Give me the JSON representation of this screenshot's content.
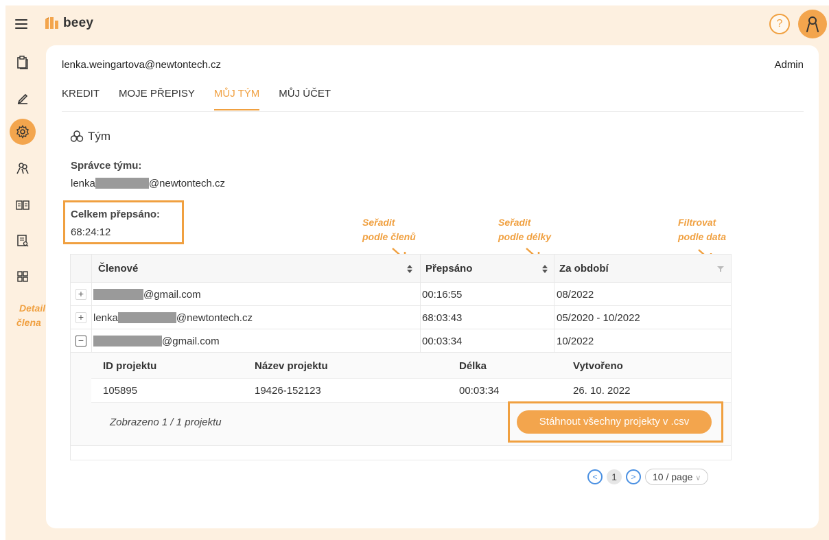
{
  "app": {
    "logo_text": "beey"
  },
  "header": {
    "help_symbol": "?"
  },
  "sidebar": {
    "items": [
      {
        "icon": "clipboard-icon"
      },
      {
        "icon": "pencil-icon"
      },
      {
        "icon": "gear-icon",
        "active": true
      },
      {
        "icon": "team-icon"
      },
      {
        "icon": "book-icon"
      },
      {
        "icon": "document-search-icon"
      },
      {
        "icon": "grid-icon"
      }
    ]
  },
  "account": {
    "email": "lenka.weingartova@newtontech.cz",
    "role": "Admin"
  },
  "tabs": [
    "KREDIT",
    "MOJE PŘEPISY",
    "MŮJ TÝM",
    "MŮJ ÚČET"
  ],
  "team": {
    "title": "Tým",
    "admin_label": "Správce týmu:",
    "admin_email_prefix": "lenka",
    "admin_email_suffix": "@newtontech.cz",
    "total_label": "Celkem přepsáno:",
    "total_value": "68:24:12"
  },
  "annotations": {
    "sort_members": [
      "Seřadit",
      "podle členů"
    ],
    "sort_length": [
      "Seřadit",
      "podle délky"
    ],
    "filter_date": [
      "Filtrovat",
      "podle data"
    ],
    "member_detail": [
      "Detail",
      "člena"
    ]
  },
  "members_table": {
    "columns": [
      "Členové",
      "Přepsáno",
      "Za období"
    ],
    "rows": [
      {
        "prefix": "",
        "suffix": "@gmail.com",
        "transcribed": "00:16:55",
        "period": "08/2022",
        "expanded": false
      },
      {
        "prefix": "lenka",
        "suffix": "@newtontech.cz",
        "transcribed": "68:03:43",
        "period": "05/2020 - 10/2022",
        "expanded": false
      },
      {
        "prefix": "",
        "suffix": "@gmail.com",
        "transcribed": "00:03:34",
        "period": "10/2022",
        "expanded": true
      }
    ]
  },
  "projects_table": {
    "columns": [
      "ID projektu",
      "Název projektu",
      "Délka",
      "Vytvořeno"
    ],
    "rows": [
      {
        "id": "105895",
        "name": "19426-152123",
        "length": "00:03:34",
        "created": "26. 10. 2022"
      }
    ],
    "summary": "Zobrazeno 1 / 1 projektu",
    "download_button": "Stáhnout všechny projekty v .csv"
  },
  "pagination": {
    "current_page": "1",
    "page_size": "10 / page"
  },
  "colors": {
    "accent": "#f3a54d",
    "highlight": "#f0a040",
    "background": "#fdf0e0",
    "pager_blue": "#4a90e2"
  }
}
